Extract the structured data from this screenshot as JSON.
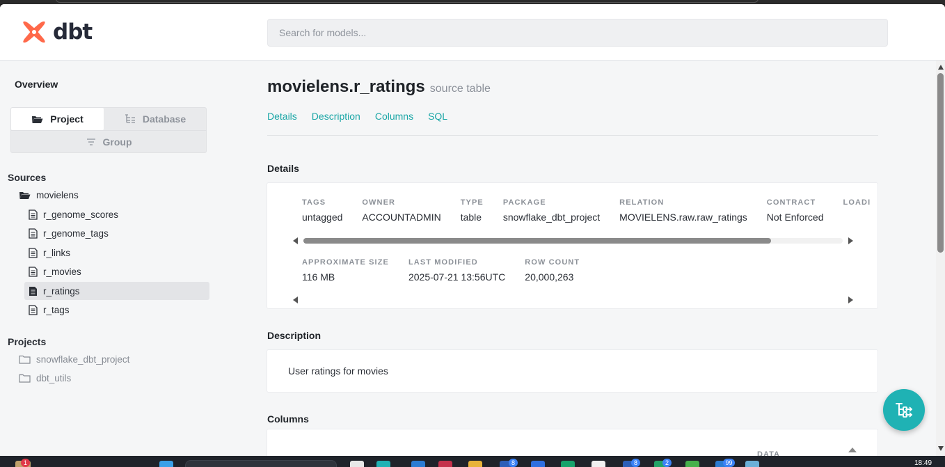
{
  "header": {
    "logo_text": "dbt",
    "search_placeholder": "Search for models..."
  },
  "sidebar": {
    "overview_label": "Overview",
    "tabs": {
      "project": "Project",
      "database": "Database",
      "group": "Group"
    },
    "sources_title": "Sources",
    "source_folder": "movielens",
    "source_items": [
      "r_genome_scores",
      "r_genome_tags",
      "r_links",
      "r_movies",
      "r_ratings",
      "r_tags"
    ],
    "active_item": "r_ratings",
    "projects_title": "Projects",
    "projects": [
      "snowflake_dbt_project",
      "dbt_utils"
    ]
  },
  "main": {
    "title": "movielens.r_ratings",
    "subtitle": "source table",
    "tabs": [
      "Details",
      "Description",
      "Columns",
      "SQL"
    ],
    "details_heading": "Details",
    "details_row1": [
      {
        "label": "TAGS",
        "value": "untagged"
      },
      {
        "label": "OWNER",
        "value": "ACCOUNTADMIN"
      },
      {
        "label": "TYPE",
        "value": "table"
      },
      {
        "label": "PACKAGE",
        "value": "snowflake_dbt_project"
      },
      {
        "label": "RELATION",
        "value": "MOVIELENS.raw.raw_ratings"
      },
      {
        "label": "CONTRACT",
        "value": "Not Enforced"
      },
      {
        "label": "LOADI",
        "value": ""
      }
    ],
    "details_row2": [
      {
        "label": "APPROXIMATE SIZE",
        "value": "116 MB"
      },
      {
        "label": "LAST MODIFIED",
        "value": "2025-07-21 13:56UTC"
      },
      {
        "label": "ROW COUNT",
        "value": "20,000,263"
      }
    ],
    "description_heading": "Description",
    "description_text": "User ratings for movies",
    "columns_heading": "Columns",
    "columns_peek_label": "DATA"
  },
  "taskbar": {
    "clock": "18:49",
    "badges": [
      "1",
      "8",
      "8",
      "2",
      "99"
    ]
  },
  "colors": {
    "accent": "#1aa6a6",
    "brand_orange": "#ff694a",
    "fab": "#1fb2b4"
  }
}
